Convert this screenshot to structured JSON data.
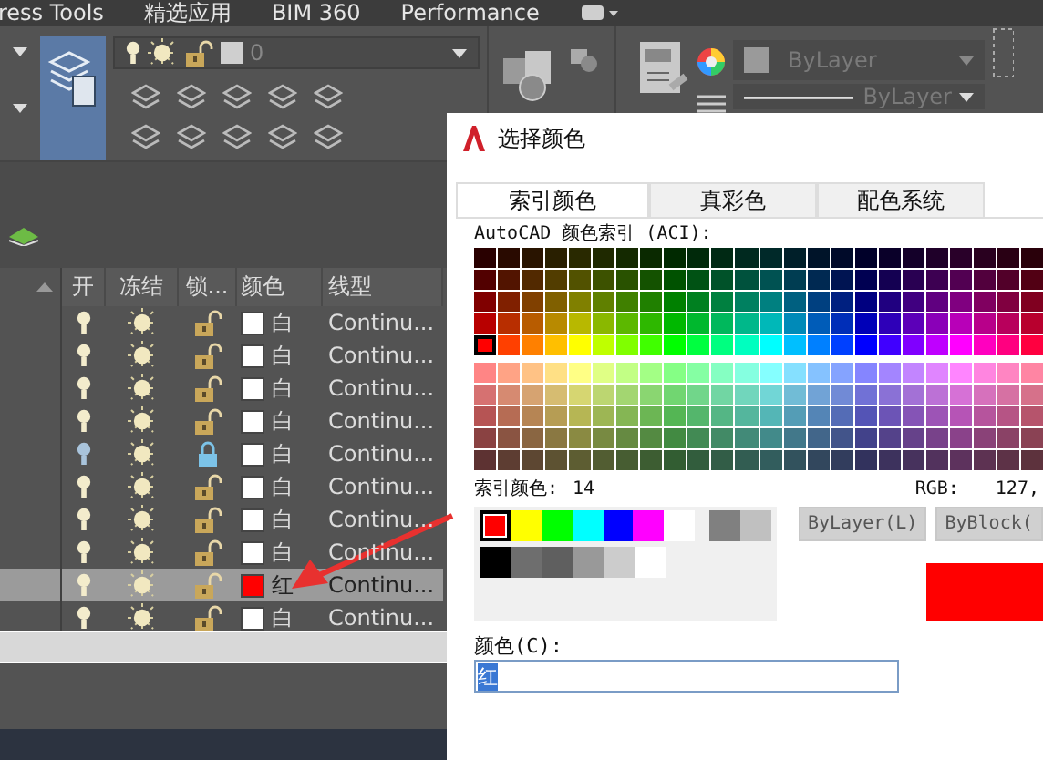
{
  "ribbon_tabs": [
    {
      "label": "ress Tools"
    },
    {
      "label": "精选应用"
    },
    {
      "label": "BIM 360"
    },
    {
      "label": "Performance"
    }
  ],
  "layer_dropdown": {
    "value": "0"
  },
  "properties": {
    "color_text": "ByLayer",
    "linetype": "ByLayer"
  },
  "layer_table": {
    "columns": [
      "开",
      "冻结",
      "锁...",
      "颜色",
      "线型"
    ],
    "rows": [
      {
        "on": true,
        "frozen": false,
        "locked": false,
        "color": "#ffffff",
        "color_name": "白",
        "linetype": "Continu...",
        "selected": false
      },
      {
        "on": true,
        "frozen": false,
        "locked": false,
        "color": "#ffffff",
        "color_name": "白",
        "linetype": "Continu...",
        "selected": false
      },
      {
        "on": true,
        "frozen": false,
        "locked": false,
        "color": "#ffffff",
        "color_name": "白",
        "linetype": "Continu...",
        "selected": false
      },
      {
        "on": true,
        "frozen": false,
        "locked": false,
        "color": "#ffffff",
        "color_name": "白",
        "linetype": "Continu...",
        "selected": false
      },
      {
        "on": true,
        "frozen": false,
        "locked": true,
        "color": "#ffffff",
        "color_name": "白",
        "linetype": "Continu...",
        "selected": false
      },
      {
        "on": true,
        "frozen": false,
        "locked": false,
        "color": "#ffffff",
        "color_name": "白",
        "linetype": "Continu...",
        "selected": false
      },
      {
        "on": true,
        "frozen": false,
        "locked": false,
        "color": "#ffffff",
        "color_name": "白",
        "linetype": "Continu...",
        "selected": false
      },
      {
        "on": true,
        "frozen": false,
        "locked": false,
        "color": "#ffffff",
        "color_name": "白",
        "linetype": "Continu...",
        "selected": false
      },
      {
        "on": true,
        "frozen": false,
        "locked": false,
        "color": "#ff0000",
        "color_name": "红",
        "linetype": "Continu...",
        "selected": true
      },
      {
        "on": true,
        "frozen": false,
        "locked": false,
        "color": "#ffffff",
        "color_name": "白",
        "linetype": "Continu...",
        "selected": false
      }
    ]
  },
  "dialog": {
    "title": "选择颜色",
    "tabs": [
      {
        "label": "索引颜色",
        "selected": true
      },
      {
        "label": "真彩色",
        "selected": false
      },
      {
        "label": "配色系统",
        "selected": false
      }
    ],
    "palette_label": "AutoCAD 颜色索引 (ACI):",
    "index_label": "索引颜色:",
    "index_value": "14",
    "rgb_label": "RGB:",
    "rgb_value": "127,",
    "standard_colors": [
      {
        "color": "#ff0000",
        "selected": true
      },
      {
        "color": "#ffff00",
        "selected": false
      },
      {
        "color": "#00ff00",
        "selected": false
      },
      {
        "color": "#00ffff",
        "selected": false
      },
      {
        "color": "#0000ff",
        "selected": false
      },
      {
        "color": "#ff00ff",
        "selected": false
      },
      {
        "color": "#ffffff",
        "selected": false
      },
      {
        "color": "#808080",
        "selected": false
      },
      {
        "color": "#c0c0c0",
        "selected": false
      }
    ],
    "gray_colors": [
      {
        "color": "#000000",
        "selected": false
      },
      {
        "color": "#6e6e6e",
        "selected": false
      },
      {
        "color": "#5f5f5f",
        "selected": false
      },
      {
        "color": "#999999",
        "selected": false
      },
      {
        "color": "#cccccc",
        "selected": false
      },
      {
        "color": "#ffffff",
        "selected": false
      }
    ],
    "buttons": [
      "ByLayer(L)",
      "ByBlock("
    ],
    "color_field_label": "颜色(C):",
    "color_field_value": "红"
  }
}
